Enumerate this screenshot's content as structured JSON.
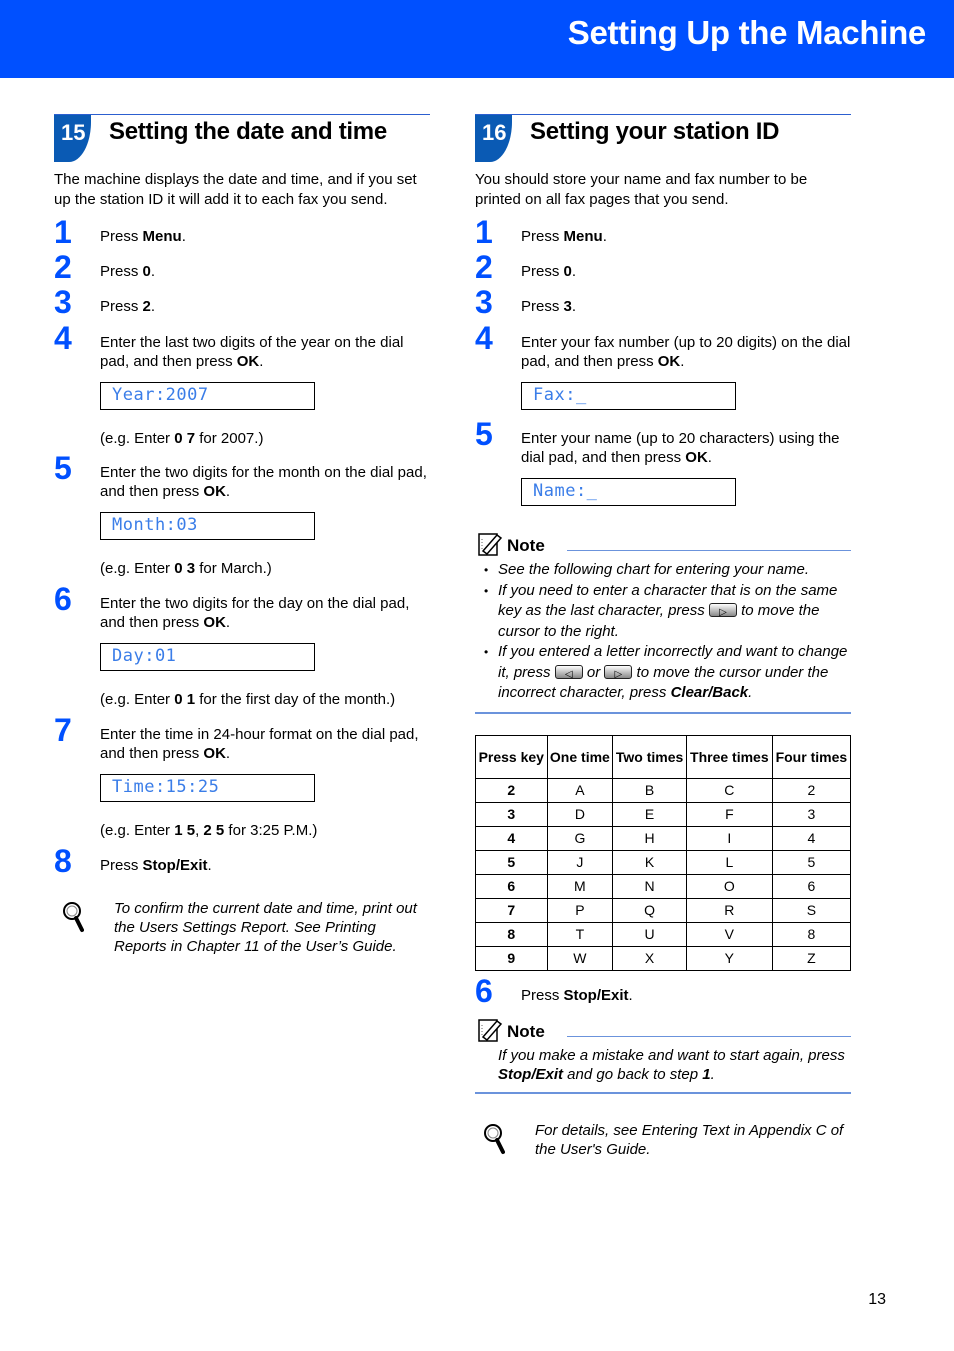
{
  "header": {
    "title": "Setting Up the Machine"
  },
  "section15": {
    "number": "15",
    "title": "Setting the date and time",
    "intro": "The machine displays the date and time, and if you set up the station ID it will add it to each fax you send.",
    "steps": [
      {
        "num": "1",
        "pre": "Press ",
        "bold": "Menu",
        "post": "."
      },
      {
        "num": "2",
        "pre": "Press ",
        "bold": "0",
        "post": "."
      },
      {
        "num": "3",
        "pre": "Press ",
        "bold": "2",
        "post": "."
      },
      {
        "num": "4",
        "pre": "Enter the last two digits of the year on the dial pad, and then press ",
        "bold": "OK",
        "post": ".",
        "lcd": "Year:2007",
        "eg_pre": "(e.g. Enter ",
        "eg_bold": "0 7",
        "eg_post": " for 2007.)"
      },
      {
        "num": "5",
        "pre": "Enter the two digits for the month on the dial pad, and then press ",
        "bold": "OK",
        "post": ".",
        "lcd": "Month:03",
        "eg_pre": "(e.g. Enter ",
        "eg_bold": "0 3",
        "eg_post": " for March.)"
      },
      {
        "num": "6",
        "pre": "Enter the two digits for the day on the dial pad, and then press ",
        "bold": "OK",
        "post": ".",
        "lcd": "Day:01",
        "eg_pre": "(e.g. Enter ",
        "eg_bold": "0 1",
        "eg_post": " for the first day of the month.)"
      },
      {
        "num": "7",
        "pre": "Enter the time in 24-hour format on the dial pad, and then press ",
        "bold": "OK",
        "post": ".",
        "lcd": "Time:15:25",
        "eg_pre": "(e.g. Enter ",
        "eg_bold": "1 5",
        "eg_mid": ", ",
        "eg_bold2": "2 5",
        "eg_post": " for 3:25 P.M.)"
      },
      {
        "num": "8",
        "pre": "Press ",
        "bold": "Stop/Exit",
        "post": "."
      }
    ],
    "tip": "To confirm the current date and time, print out the Users Settings Report. See Printing Reports in Chapter 11 of the User’s Guide."
  },
  "section16": {
    "number": "16",
    "title": "Setting your station ID",
    "intro": "You should store your name and fax number to be printed on all fax pages that you send.",
    "steps": [
      {
        "num": "1",
        "pre": "Press ",
        "bold": "Menu",
        "post": "."
      },
      {
        "num": "2",
        "pre": "Press ",
        "bold": "0",
        "post": "."
      },
      {
        "num": "3",
        "pre": "Press ",
        "bold": "3",
        "post": "."
      },
      {
        "num": "4",
        "pre": "Enter your fax number (up to 20 digits) on the dial pad, and then press ",
        "bold": "OK",
        "post": ".",
        "lcd": "Fax:_"
      },
      {
        "num": "5",
        "pre": "Enter your name (up to 20 characters) using the dial pad, and then press ",
        "bold": "OK",
        "post": ".",
        "lcd": "Name:_"
      },
      {
        "num": "6",
        "pre": "Press ",
        "bold": "Stop/Exit",
        "post": "."
      }
    ],
    "note1": {
      "label": "Note",
      "bullet1": "See the following chart for entering your name.",
      "bullet2_pre": "If you need to enter a character that is on the same key as the last character, press ",
      "bullet2_post": " to move the cursor to the right.",
      "bullet3_pre": "If you entered a letter incorrectly and want to change it, press ",
      "bullet3_or": " or ",
      "bullet3_mid": " to move the cursor under the incorrect character, press ",
      "bullet3_bold": "Clear/Back",
      "bullet3_post": "."
    },
    "table": {
      "headers": [
        "Press key",
        "One time",
        "Two times",
        "Three times",
        "Four times"
      ],
      "rows": [
        [
          "2",
          "A",
          "B",
          "C",
          "2"
        ],
        [
          "3",
          "D",
          "E",
          "F",
          "3"
        ],
        [
          "4",
          "G",
          "H",
          "I",
          "4"
        ],
        [
          "5",
          "J",
          "K",
          "L",
          "5"
        ],
        [
          "6",
          "M",
          "N",
          "O",
          "6"
        ],
        [
          "7",
          "P",
          "Q",
          "R",
          "S"
        ],
        [
          "8",
          "T",
          "U",
          "V",
          "8"
        ],
        [
          "9",
          "W",
          "X",
          "Y",
          "Z"
        ]
      ]
    },
    "note2": {
      "label": "Note",
      "pre": "If you make a mistake and want to start again, press ",
      "bold": "Stop/Exit",
      "mid": " and go back to step ",
      "bold2": "1",
      "post": "."
    },
    "tip": "For details, see Entering Text in Appendix C of the User's Guide."
  },
  "icons": {
    "right_key": "▷",
    "left_key": "◁"
  },
  "footer": {
    "page_number": "13"
  }
}
